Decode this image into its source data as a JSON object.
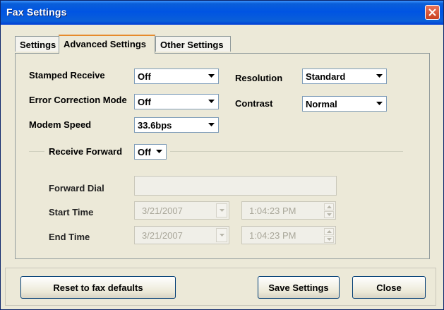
{
  "window": {
    "title": "Fax Settings"
  },
  "tabs": [
    {
      "label": "Settings"
    },
    {
      "label": "Advanced Settings"
    },
    {
      "label": "Other Settings"
    }
  ],
  "fields": {
    "stamped_receive": {
      "label": "Stamped Receive",
      "value": "Off"
    },
    "error_correction": {
      "label": "Error Correction Mode",
      "value": "Off"
    },
    "modem_speed": {
      "label": "Modem Speed",
      "value": "33.6bps"
    },
    "resolution": {
      "label": "Resolution",
      "value": "Standard"
    },
    "contrast": {
      "label": "Contrast",
      "value": "Normal"
    },
    "receive_forward": {
      "label": "Receive Forward",
      "value": "Off"
    },
    "forward_dial": {
      "label": "Forward Dial",
      "value": ""
    },
    "start_time": {
      "label": "Start Time",
      "date": "3/21/2007",
      "time": "1:04:23 PM"
    },
    "end_time": {
      "label": "End Time",
      "date": "3/21/2007",
      "time": "1:04:23 PM"
    }
  },
  "buttons": {
    "reset": "Reset to fax defaults",
    "save": "Save Settings",
    "close": "Close"
  },
  "icons": {
    "close": "close-icon",
    "dropdown": "chevron-down-icon",
    "spin_up": "spin-up-icon",
    "spin_down": "spin-down-icon"
  }
}
